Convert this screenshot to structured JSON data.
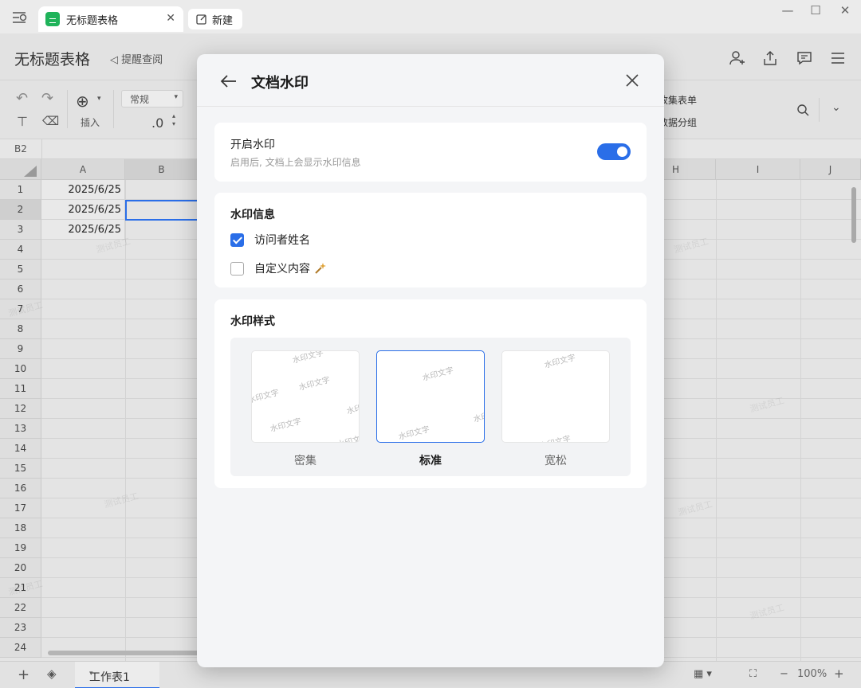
{
  "window": {
    "active_tab": "无标题表格",
    "new_tab": "新建"
  },
  "doc": {
    "title": "无标题表格",
    "remind": "提醒查阅"
  },
  "toolbar": {
    "insert_label": "插入",
    "format_value": "常规",
    "decimal_label": ".0",
    "collect_form": "收集表单",
    "data_group": "数据分组"
  },
  "formula": {
    "cell_ref": "B2"
  },
  "grid": {
    "columns": [
      "A",
      "B",
      "H",
      "I",
      "J"
    ],
    "rows": [
      "1",
      "2",
      "3",
      "4",
      "5",
      "6",
      "7",
      "8",
      "9",
      "10",
      "11",
      "12",
      "13",
      "14",
      "15",
      "16",
      "17",
      "18",
      "19",
      "20",
      "21",
      "22",
      "23",
      "24"
    ],
    "cells_a": [
      "2025/6/25",
      "2025/6/25",
      "2025/6/25"
    ],
    "watermark": "测试员工"
  },
  "bottom": {
    "sheet_name": "工作表1",
    "zoom": "100%"
  },
  "dialog": {
    "title": "文档水印",
    "toggle": {
      "title": "开启水印",
      "subtitle": "启用后, 文档上会显示水印信息",
      "on": true
    },
    "info": {
      "title": "水印信息",
      "options": [
        {
          "label": "访问者姓名",
          "checked": true
        },
        {
          "label": "自定义内容",
          "checked": false
        }
      ]
    },
    "style": {
      "title": "水印样式",
      "thumb_text": "水印文字",
      "options": [
        {
          "label": "密集",
          "selected": false
        },
        {
          "label": "标准",
          "selected": true
        },
        {
          "label": "宽松",
          "selected": false
        }
      ]
    }
  },
  "colors": {
    "accent": "#2a6ee8",
    "tab_icon": "#1fb35a"
  }
}
